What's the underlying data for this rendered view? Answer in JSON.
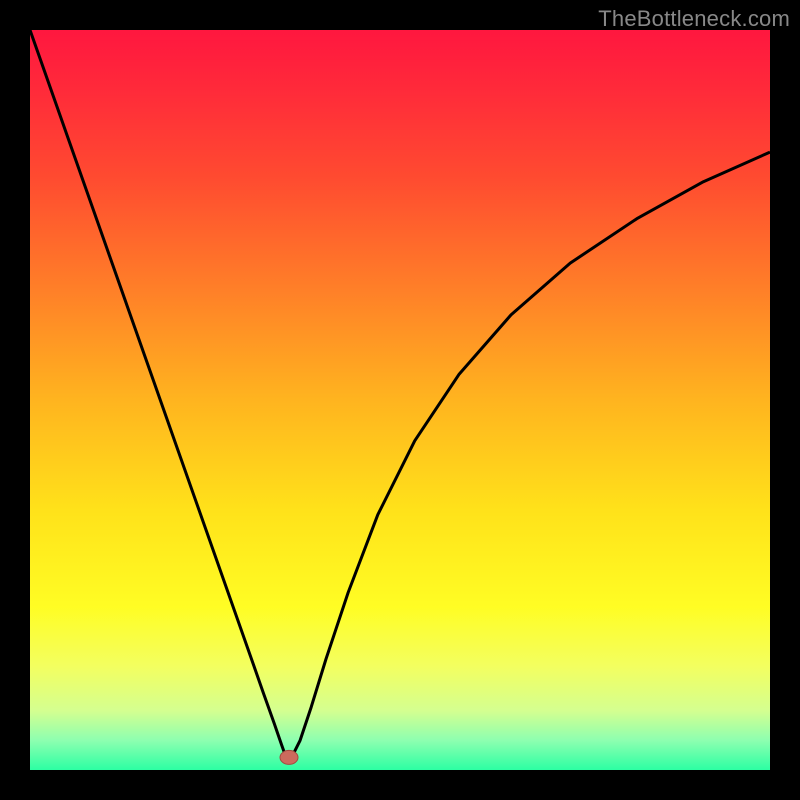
{
  "watermark": "TheBottleneck.com",
  "colors": {
    "gradient_stops": [
      {
        "offset": 0.0,
        "color": "#ff173f"
      },
      {
        "offset": 0.08,
        "color": "#ff2a3a"
      },
      {
        "offset": 0.2,
        "color": "#ff4b30"
      },
      {
        "offset": 0.35,
        "color": "#ff7f28"
      },
      {
        "offset": 0.5,
        "color": "#ffb41f"
      },
      {
        "offset": 0.65,
        "color": "#ffe21a"
      },
      {
        "offset": 0.78,
        "color": "#fffd24"
      },
      {
        "offset": 0.86,
        "color": "#f3ff60"
      },
      {
        "offset": 0.92,
        "color": "#d4ff90"
      },
      {
        "offset": 0.96,
        "color": "#8dffb0"
      },
      {
        "offset": 1.0,
        "color": "#2cffa3"
      }
    ],
    "curve": "#000000",
    "marker_fill": "#cc6a5d",
    "marker_stroke": "#a24b40",
    "frame": "#000000"
  },
  "chart_data": {
    "type": "line",
    "title": "",
    "xlabel": "",
    "ylabel": "",
    "xlim": [
      0,
      100
    ],
    "ylim": [
      0,
      100
    ],
    "grid": false,
    "legend": false,
    "series": [
      {
        "name": "bottleneck-curve",
        "x": [
          0.0,
          5.0,
          10.0,
          15.0,
          20.0,
          25.0,
          30.0,
          31.5,
          33.0,
          34.0,
          34.5,
          35.5,
          36.5,
          38.0,
          40.0,
          43.0,
          47.0,
          52.0,
          58.0,
          65.0,
          73.0,
          82.0,
          91.0,
          100.0
        ],
        "values": [
          100.0,
          85.8,
          71.6,
          57.4,
          43.2,
          29.0,
          14.8,
          10.5,
          6.3,
          3.4,
          2.0,
          2.0,
          4.0,
          8.5,
          15.0,
          24.0,
          34.5,
          44.5,
          53.5,
          61.5,
          68.5,
          74.5,
          79.5,
          83.5
        ]
      }
    ],
    "marker": {
      "name": "optimum-point",
      "x": 35.0,
      "y": 1.7
    }
  }
}
